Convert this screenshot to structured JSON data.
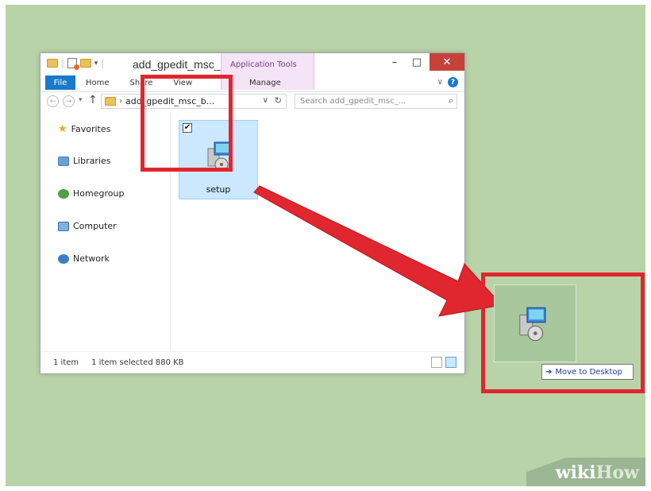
{
  "window": {
    "title": "add_gpedit_msc_...",
    "context_tab_group": "Application Tools",
    "controls": {
      "minimize": "–",
      "maximize": "□",
      "close": "✕"
    }
  },
  "ribbon": {
    "tabs": [
      {
        "label": "File"
      },
      {
        "label": "Home"
      },
      {
        "label": "Share"
      },
      {
        "label": "View"
      },
      {
        "label": "Manage"
      }
    ],
    "expand_glyph": "∨",
    "help_glyph": "?"
  },
  "address": {
    "back_glyph": "←",
    "forward_glyph": "→",
    "recent_glyph": "▾",
    "up_glyph": "↑",
    "chevron": "›",
    "path": "add_gpedit_msc_b...",
    "dropdown_glyph": "∨",
    "refresh_glyph": "↻",
    "search_placeholder": "Search add_gpedit_msc_...",
    "search_glyph": "⌕"
  },
  "nav_pane": {
    "items": [
      {
        "label": "Favorites",
        "icon": "star-icon"
      },
      {
        "label": "Libraries",
        "icon": "libraries-icon"
      },
      {
        "label": "Homegroup",
        "icon": "homegroup-icon"
      },
      {
        "label": "Computer",
        "icon": "computer-icon"
      },
      {
        "label": "Network",
        "icon": "network-icon"
      }
    ]
  },
  "content": {
    "file": {
      "name": "setup",
      "checked_glyph": "✔",
      "icon": "installer-icon"
    }
  },
  "status": {
    "count": "1 item",
    "selection": "1 item selected  880 KB"
  },
  "drag": {
    "tooltip_arrow": "➔",
    "tooltip": "Move to Desktop"
  },
  "brand": {
    "wiki": "wiki",
    "how": "How"
  },
  "colors": {
    "background": "#b9d3a9",
    "highlight": "#e0262f",
    "file_tab": "#1979ca",
    "context_tab": "#f5e3f7",
    "selection": "#cce8ff"
  }
}
